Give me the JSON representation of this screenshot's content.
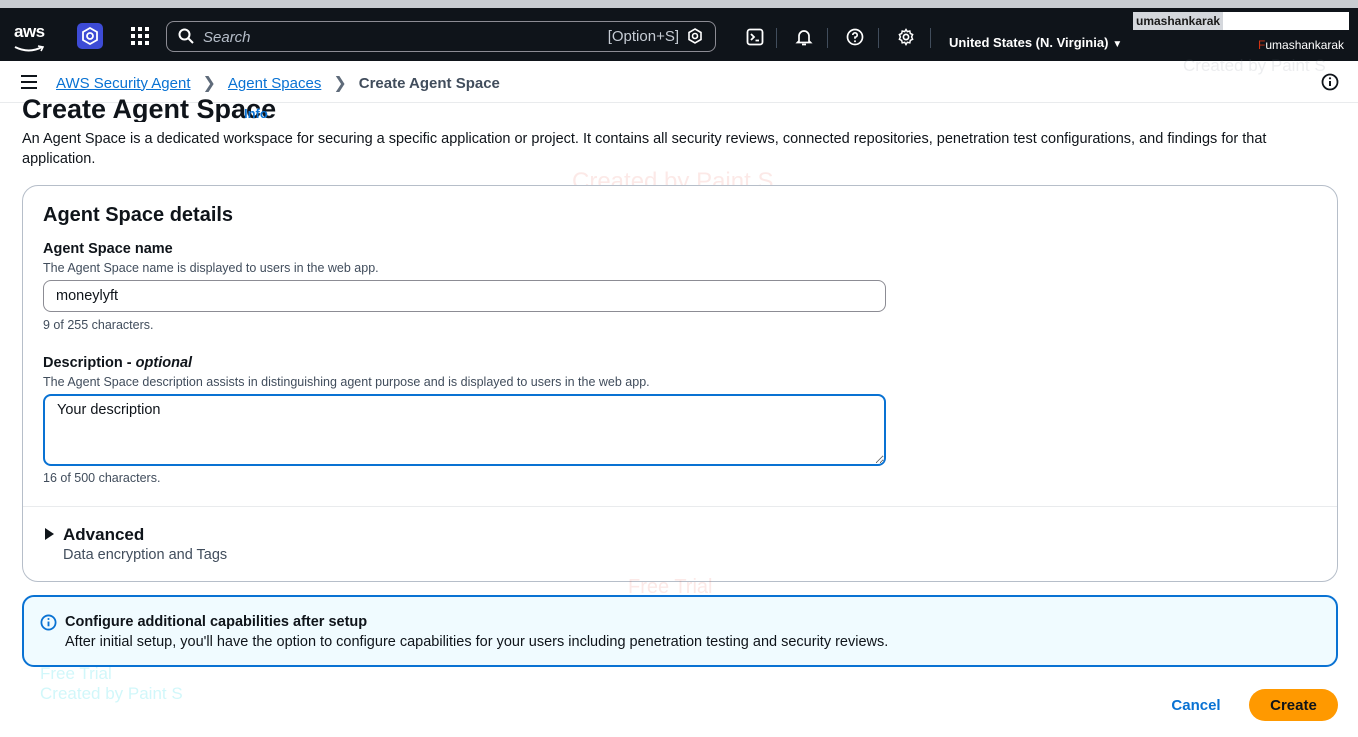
{
  "topnav": {
    "logo_text": "aws",
    "search_placeholder": "Search",
    "search_shortcut": "[Option+S]",
    "region": "United States (N. Virginia)",
    "user_label": "umashankarak",
    "user_name": "umashankarak",
    "user_name_mark": "F",
    "icons": [
      "cloudshell-icon",
      "bell-icon",
      "help-icon",
      "gear-icon"
    ]
  },
  "breadcrumb": {
    "items": [
      "AWS Security Agent",
      "Agent Spaces"
    ],
    "current": "Create Agent Space"
  },
  "page": {
    "title": "Create Agent Space",
    "info_link": "Info",
    "description": "An Agent Space is a dedicated workspace for securing a specific application or project. It contains all security reviews, connected repositories, penetration test configurations, and findings for that application."
  },
  "details": {
    "title": "Agent Space details",
    "name_label": "Agent Space name",
    "name_hint": "The Agent Space name is displayed to users in the web app.",
    "name_value": "moneylyft",
    "name_count": "9 of 255 characters.",
    "desc_label": "Description - ",
    "desc_label_optional": "optional",
    "desc_hint": "The Agent Space description assists in distinguishing agent purpose and is displayed to users in the web app.",
    "desc_value": "Your description",
    "desc_count": "16 of 500 characters.",
    "advanced_title": "Advanced",
    "advanced_subtitle": "Data encryption and Tags"
  },
  "alert": {
    "title": "Configure additional capabilities after setup",
    "body": "After initial setup, you'll have the option to configure capabilities for your users including penetration testing and security reviews."
  },
  "footer": {
    "cancel_label": "Cancel",
    "create_label": "Create"
  },
  "watermarks": {
    "created_by": "Created by Paint S",
    "free_trial": "Free Trial"
  },
  "colors": {
    "nav_bg": "#0f141a",
    "link": "#0972d3",
    "primary_button": "#ff9900",
    "alert_bg": "#f0fbff"
  }
}
